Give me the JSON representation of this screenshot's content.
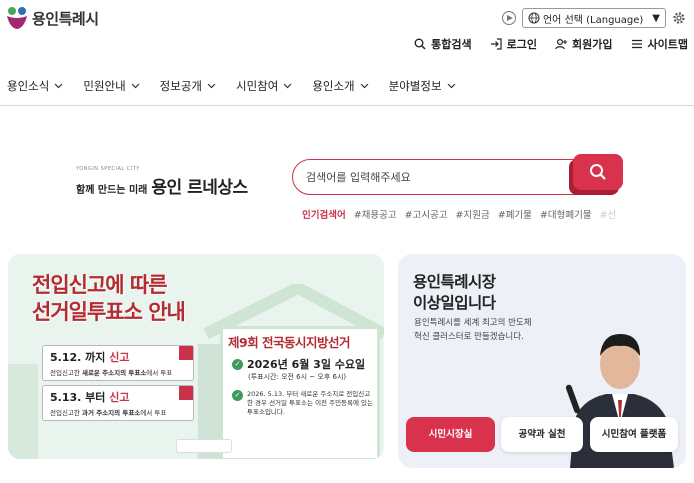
{
  "header": {
    "logo_text": "용인특례시",
    "language_label": "언어 선택 (Language)",
    "util": [
      "통합검색",
      "로그인",
      "회원가입",
      "사이트맵"
    ]
  },
  "nav": [
    "용인소식",
    "민원안내",
    "정보공개",
    "시민참여",
    "용인소개",
    "분야별정보"
  ],
  "brand": {
    "small": "YONGIN SPECIAL CITY",
    "sub": "함께 만드는 미래",
    "main": "용인 르네상스"
  },
  "search": {
    "placeholder": "검색어를 입력해주세요",
    "popular_label": "인기검색어",
    "popular": [
      "#채용공고",
      "#고시공고",
      "#지원금",
      "#폐기물",
      "#대형폐기물",
      "#선"
    ]
  },
  "banner": {
    "title_line1": "전입신고에 따른",
    "title_line2": "선거일투표소 안내",
    "card1_date": "5.12. 까지",
    "card1_word": "신고",
    "card1_desc_pre": "전입신고한 ",
    "card1_desc_bold": "새로운 주소지의 투표소",
    "card1_desc_post": "에서 투표",
    "card2_date": "5.13. 부터",
    "card2_word": "신고",
    "card2_desc_pre": "전입신고한 ",
    "card2_desc_bold": "과거 주소지의 투표소",
    "card2_desc_post": "에서 투표",
    "election_title": "제9회 전국동시지방선거",
    "election_date": "2026년 6월 3일 수요일",
    "election_time": "(투표시간: 오전 6시 ~ 오후 6시)",
    "election_note": "2026. 5.13. 부터 새로운 주소지로 전입신고한 경우 선거일 투표소는 이전 주민등록에 있는 투표소입니다."
  },
  "mayor": {
    "title_line1": "용인특례시장",
    "title_line2": "이상일입니다",
    "desc": "용인특례시를 세계 최고의 반도체 혁신 클러스터로 만들겠습니다.",
    "buttons": [
      "시민시장실",
      "공약과 실천",
      "시민참여 플랫폼"
    ]
  },
  "colors": {
    "accent": "#d9324d",
    "banner_bg": "#eaf4ee",
    "panel_bg": "#eef0f7"
  }
}
